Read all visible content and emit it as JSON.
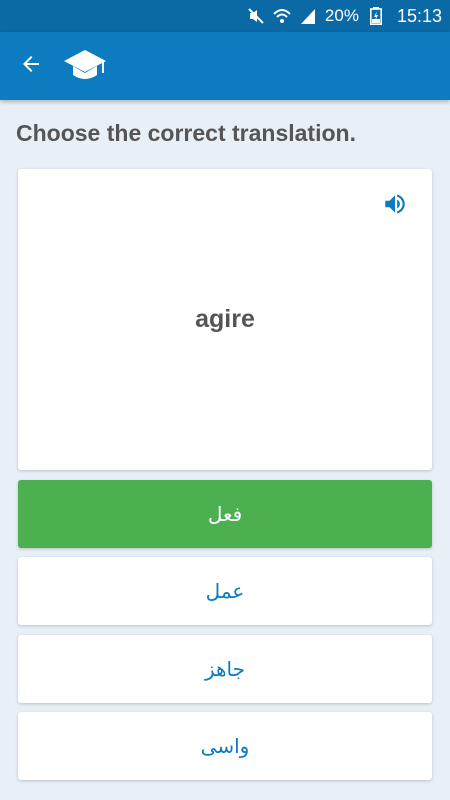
{
  "status_bar": {
    "battery_percent": "20%",
    "time": "15:13",
    "icons": [
      "mute-icon",
      "wifi-icon",
      "signal-icon",
      "battery-charging-icon"
    ]
  },
  "app_bar": {
    "back_icon": "arrow-left-icon",
    "logo_icon": "graduation-cap-icon"
  },
  "quiz": {
    "instruction": "Choose the correct translation.",
    "word": "agire",
    "speaker_icon": "speaker-icon",
    "options": [
      {
        "label": "فعل",
        "state": "correct"
      },
      {
        "label": "عمل",
        "state": "default"
      },
      {
        "label": "جاهز",
        "state": "default"
      },
      {
        "label": "واسى",
        "state": "default"
      }
    ]
  },
  "colors": {
    "status_bar": "#0b6aa5",
    "app_bar": "#0c7bc0",
    "background": "#e8f0f7",
    "correct": "#4caf50",
    "option_text": "#0c7bc0"
  }
}
